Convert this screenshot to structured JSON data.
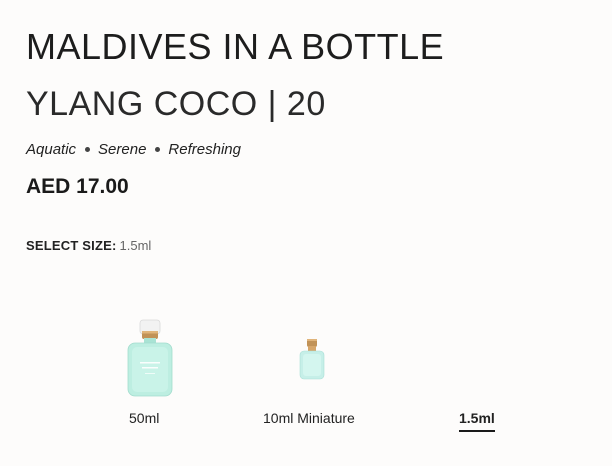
{
  "product": {
    "title": "MALDIVES IN A BOTTLE",
    "subtitle": "YLANG COCO | 20",
    "notes": [
      "Aquatic",
      "Serene",
      "Refreshing"
    ],
    "price": "AED 17.00"
  },
  "size_selector": {
    "label": "SELECT SIZE:",
    "selected_value": "1.5ml",
    "options": [
      {
        "label": "50ml",
        "selected": false
      },
      {
        "label": "10ml Miniature",
        "selected": false
      },
      {
        "label": "1.5ml",
        "selected": true
      }
    ]
  },
  "colors": {
    "bottle_teal": "#bfeee2",
    "cap_gold": "#b98a4f",
    "text_dark": "#1d1d1d"
  }
}
